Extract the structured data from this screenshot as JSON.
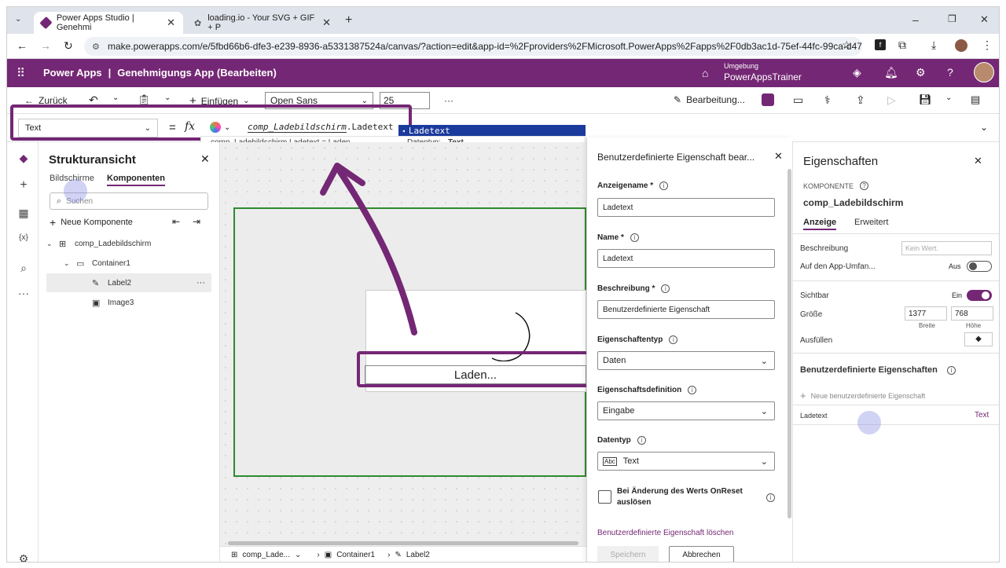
{
  "browser": {
    "tabs": [
      {
        "title": "Power Apps Studio | Genehmi"
      },
      {
        "title": "loading.io - Your SVG + GIF + P"
      }
    ],
    "url": "make.powerapps.com/e/5fbd66b6-dfe3-e239-8936-a5331387524a/canvas/?action=edit&app-id=%2Fproviders%2FMicrosoft.PowerApps%2Fapps%2F0db3ac1d-75ef-44fc-99ca-d47..."
  },
  "app": {
    "brand": "Power Apps",
    "sep": "|",
    "title": "Genehmigungs App (Bearbeiten)",
    "env_label": "Umgebung",
    "env_name": "PowerAppsTrainer"
  },
  "command": {
    "back": "Zurück",
    "insert": "Einfügen",
    "font": "Open Sans",
    "size": "25",
    "more": "···",
    "edit": "Bearbeitung..."
  },
  "formula": {
    "property": "Text",
    "equals": "=",
    "fx": "fx",
    "expr_part1": "comp_Ladebildschirm",
    "expr_part2": ".Ladetext",
    "suggest": "Ladetext",
    "result": "comp_Ladebildschirm.Ladetext  =  Laden...",
    "datatype_label": "Datentyp:",
    "datatype_value": "Text"
  },
  "tree": {
    "title": "Strukturansicht",
    "tab_screens": "Bildschirme",
    "tab_components": "Komponenten",
    "search_placeholder": "Suchen",
    "new_component": "Neue Komponente",
    "items": [
      {
        "label": "comp_Ladebildschirm"
      },
      {
        "label": "Container1"
      },
      {
        "label": "Label2"
      },
      {
        "label": "Image3"
      }
    ],
    "item_more": "···"
  },
  "canvas": {
    "loading_text": "Laden..."
  },
  "statusbar": {
    "crumb1": "comp_Lade...",
    "crumb2": "Container1",
    "crumb3": "Label2"
  },
  "custom_prop": {
    "title": "Benutzerdefinierte Eigenschaft bear...",
    "display_name_label": "Anzeigename",
    "display_name_value": "Ladetext",
    "name_label": "Name",
    "name_value": "Ladetext",
    "desc_label": "Beschreibung",
    "desc_value": "Benutzerdefinierte Eigenschaft",
    "type_label": "Eigenschaftentyp",
    "type_value": "Daten",
    "def_label": "Eigenschaftsdefinition",
    "def_value": "Eingabe",
    "datatype_label": "Datentyp",
    "datatype_value": "Text",
    "onreset_label": "Bei Änderung des Werts OnReset auslösen",
    "delete_link": "Benutzerdefinierte Eigenschaft löschen",
    "save": "Speichern",
    "cancel": "Abbrechen",
    "required": "*"
  },
  "props": {
    "title": "Eigenschaften",
    "section": "KOMPONENTE",
    "component_name": "comp_Ladebildschirm",
    "tab_display": "Anzeige",
    "tab_advanced": "Erweitert",
    "desc_label": "Beschreibung",
    "desc_placeholder": "Kein Wert.",
    "scope_label": "Auf den App-Umfan...",
    "scope_value": "Aus",
    "visible_label": "Sichtbar",
    "visible_value": "Ein",
    "size_label": "Größe",
    "width": "1377",
    "height": "768",
    "width_label": "Breite",
    "height_label": "Höhe",
    "fill_label": "Ausfüllen",
    "custom_title": "Benutzerdefinierte Eigenschaften",
    "new_custom": "Neue benutzerdefinierte Eigenschaft",
    "custom_item": "Ladetext",
    "custom_item_type": "Text"
  },
  "colors": {
    "brand": "#742774",
    "link": "#742774"
  }
}
